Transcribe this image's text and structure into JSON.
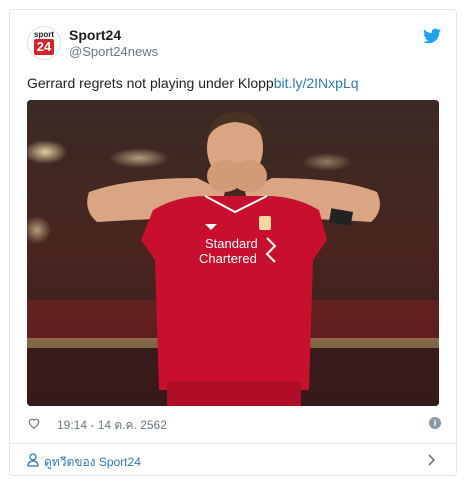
{
  "tweet": {
    "avatar_top": "sport",
    "avatar_bottom": "24",
    "display_name": "Sport24",
    "handle": "@Sport24news",
    "text": "Gerrard regrets not playing under Klopp",
    "link": "bit.ly/2INxpLq",
    "timestamp": "19:14 - 14 ต.ค. 2562",
    "info_glyph": "i"
  },
  "photo": {
    "sponsor_line1": "Standard",
    "sponsor_line2": "Chartered",
    "shirt_color": "#c8102e"
  },
  "footer": {
    "label": "ดูทวีตของ Sport24"
  },
  "colors": {
    "link": "#2b7bb9",
    "twitter_blue": "#1da1f2",
    "muted": "#697882",
    "border": "#e1e8ed"
  },
  "icons": [
    "twitter-bird-icon",
    "heart-icon",
    "info-icon",
    "person-icon",
    "chevron-right-icon"
  ]
}
